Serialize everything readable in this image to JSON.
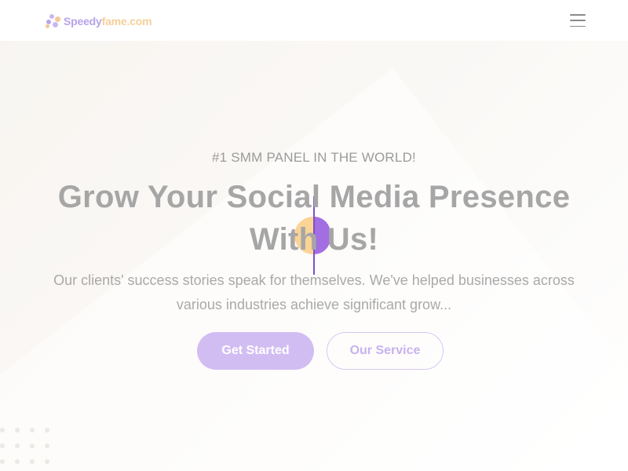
{
  "header": {
    "logo_part1": "Speedy",
    "logo_part2": "fame.com",
    "menu_icon": "hamburger-menu-icon"
  },
  "hero": {
    "eyebrow": "#1 SMM PANEL IN THE WORLD!",
    "title_line1": "Grow Your Social Media Presence",
    "title_line2": "With Us!",
    "subtitle": "Our clients' success stories speak for themselves. We've helped businesses across various industries achieve significant grow...",
    "primary_button": "Get Started",
    "secondary_button": "Our Service"
  },
  "colors": {
    "accent_purple": "#9a5ee0",
    "accent_orange": "#f9cf8a",
    "button_fill": "#d2bdf3"
  }
}
